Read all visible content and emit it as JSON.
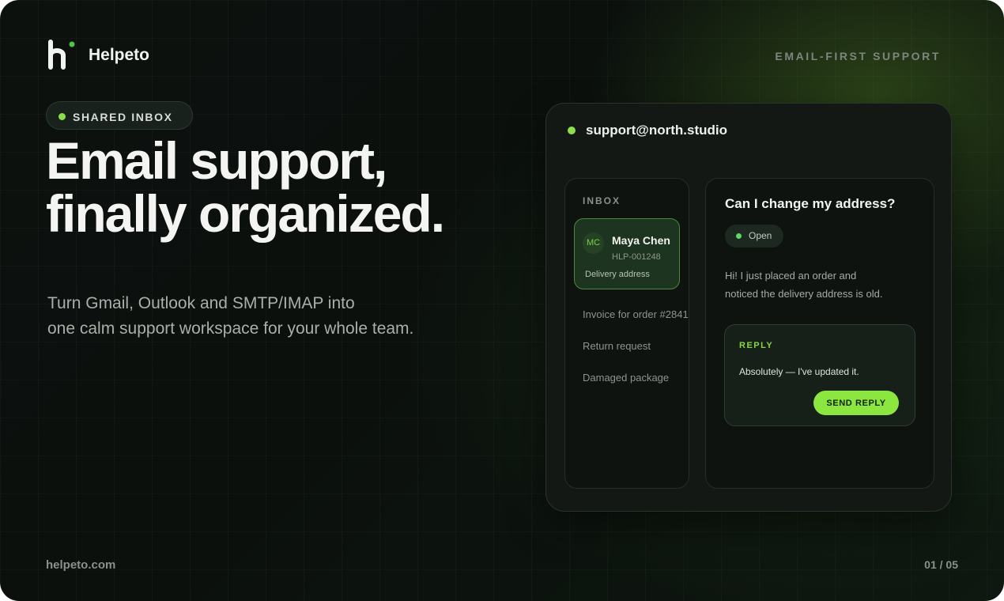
{
  "brand": {
    "name": "Helpeto",
    "tagline": "EMAIL-FIRST SUPPORT",
    "accent": "#8be04a"
  },
  "hero": {
    "pill": "SHARED INBOX",
    "headline": [
      "Email support,",
      "finally organized."
    ],
    "subtitle": [
      "Turn Gmail, Outlook and SMTP/IMAP into",
      "one calm support workspace for your whole team."
    ]
  },
  "app": {
    "account": "support@north.studio",
    "inbox": {
      "label": "INBOX",
      "active": {
        "initials": "MC",
        "name": "Maya Chen",
        "ticket_id": "HLP-001248",
        "subject": "Delivery address"
      },
      "items": [
        "Invoice for order #2841",
        "Return request",
        "Damaged package"
      ]
    },
    "detail": {
      "subject": "Can I change my address?",
      "status": "Open",
      "message": [
        "Hi! I just placed an order and",
        "noticed the delivery address is old."
      ],
      "reply": {
        "label": "REPLY",
        "text": "Absolutely — I've updated it.",
        "button": "SEND REPLY"
      }
    }
  },
  "footer": {
    "url": "helpeto.com",
    "page": "01 / 05"
  }
}
